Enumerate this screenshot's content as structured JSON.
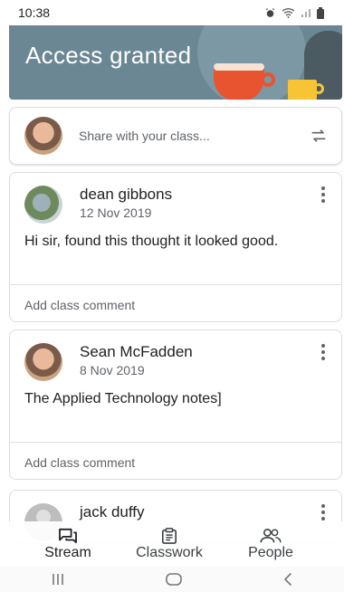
{
  "status_bar": {
    "time": "10:38"
  },
  "banner": {
    "title": "Access granted"
  },
  "share": {
    "placeholder": "Share with your class..."
  },
  "posts": [
    {
      "author": "dean gibbons",
      "date": "12 Nov 2019",
      "body": "Hi sir, found this thought it looked good.",
      "comment_label": "Add class comment"
    },
    {
      "author": "Sean McFadden",
      "date": "8 Nov 2019",
      "body": "The Applied Technology notes]",
      "comment_label": "Add class comment"
    },
    {
      "author": "jack duffy",
      "date": "",
      "body": "",
      "comment_label": ""
    }
  ],
  "bottom_nav": [
    {
      "label": "Stream",
      "icon": "stream-icon",
      "active": true
    },
    {
      "label": "Classwork",
      "icon": "classwork-icon",
      "active": false
    },
    {
      "label": "People",
      "icon": "people-icon",
      "active": false
    }
  ],
  "system_nav": {
    "icons": [
      "recent-apps-icon",
      "home-icon",
      "back-icon"
    ]
  },
  "colors": {
    "banner": "#6b8794",
    "accent": "#202124",
    "secondary_text": "#5f6368",
    "divider": "#e0e0e0"
  }
}
